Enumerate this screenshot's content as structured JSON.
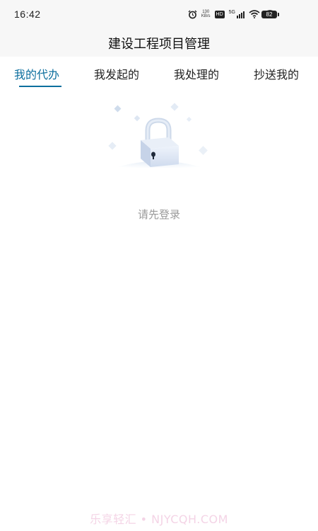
{
  "status_bar": {
    "time": "16:42",
    "net_speed_value": "130",
    "net_speed_unit": "KB/s",
    "hd_label": "HD",
    "network_label": "5G",
    "battery": "82"
  },
  "header": {
    "title": "建设工程项目管理"
  },
  "tabs": [
    {
      "label": "我的代办",
      "active": true
    },
    {
      "label": "我发起的",
      "active": false
    },
    {
      "label": "我处理的",
      "active": false
    },
    {
      "label": "抄送我的",
      "active": false
    }
  ],
  "empty_state": {
    "icon": "lock-icon",
    "message": "请先登录"
  },
  "watermark": "乐享轻汇 • NJYCQH.COM",
  "colors": {
    "accent": "#0d6f9e",
    "header_bg": "#f7f7f7",
    "muted_text": "#9a9a9a"
  }
}
